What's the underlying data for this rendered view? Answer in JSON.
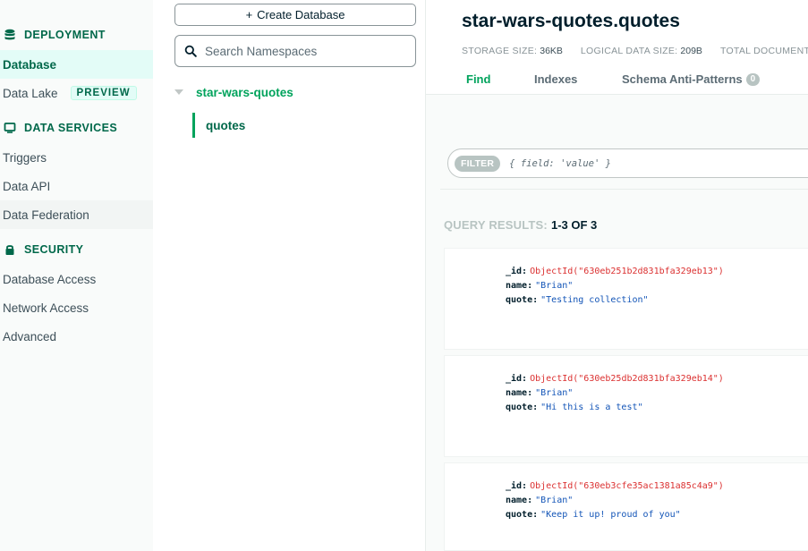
{
  "sidebar": {
    "deployment_label": "DEPLOYMENT",
    "database_label": "Database",
    "data_lake_label": "Data Lake",
    "preview_badge": "PREVIEW",
    "data_services_label": "DATA SERVICES",
    "triggers_label": "Triggers",
    "data_api_label": "Data API",
    "data_federation_label": "Data Federation",
    "security_label": "SECURITY",
    "database_access_label": "Database Access",
    "network_access_label": "Network Access",
    "advanced_label": "Advanced"
  },
  "namespaces": {
    "create_button": "Create Database",
    "search_placeholder": "Search Namespaces",
    "database_name": "star-wars-quotes",
    "collection_name": "quotes"
  },
  "collection": {
    "title": "star-wars-quotes.quotes",
    "storage_size_label": "STORAGE SIZE:",
    "storage_size_value": "36KB",
    "logical_size_label": "LOGICAL DATA SIZE:",
    "logical_size_value": "209B",
    "total_docs_label": "TOTAL DOCUMENTS"
  },
  "tabs": {
    "find": "Find",
    "indexes": "Indexes",
    "schema": "Schema Anti-Patterns",
    "schema_count": "0"
  },
  "filter": {
    "button": "FILTER",
    "placeholder": "{ field: 'value' }"
  },
  "results": {
    "label": "QUERY RESULTS:",
    "range": "1-3 OF 3"
  },
  "documents": [
    {
      "id_key": "_id:",
      "id_value": "ObjectId(\"630eb251b2d831bfa329eb13\")",
      "name_key": "name:",
      "name_value": "\"Brian\"",
      "quote_key": "quote:",
      "quote_value": "\"Testing collection\""
    },
    {
      "id_key": "_id:",
      "id_value": "ObjectId(\"630eb25db2d831bfa329eb14\")",
      "name_key": "name:",
      "name_value": "\"Brian\"",
      "quote_key": "quote:",
      "quote_value": "\"Hi this is a test\""
    },
    {
      "id_key": "_id:",
      "id_value": "ObjectId(\"630eb3cfe35ac1381a85c4a9\")",
      "name_key": "name:",
      "name_value": "\"Brian\"",
      "quote_key": "quote:",
      "quote_value": "\"Keep it up! proud of you\""
    }
  ],
  "colors": {
    "brand_green": "#00a35c",
    "dark_green": "#00684a",
    "objectid_red": "#db3030",
    "string_blue": "#1254b7"
  },
  "icons": {
    "deployment": "database-stack-icon",
    "data_services": "monitor-icon",
    "security": "lock-icon",
    "search": "search-icon",
    "tree_toggle": "caret-down-icon"
  }
}
